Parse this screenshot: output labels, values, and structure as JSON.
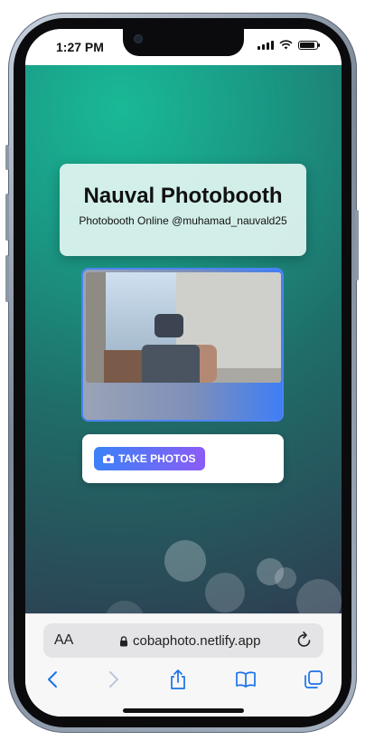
{
  "status_bar": {
    "time": "1:27 PM"
  },
  "app": {
    "title": "Nauval Photobooth",
    "subtitle": "Photobooth Online @muhamad_nauvald25",
    "take_photos_label": "TAKE PHOTOS"
  },
  "browser": {
    "url": "cobaphoto.netlify.app",
    "aa_label": "AA",
    "toolbar": [
      "back",
      "forward",
      "share",
      "bookmarks",
      "tabs"
    ]
  },
  "icons": {
    "camera": "camera-icon",
    "lock": "lock-icon",
    "reload": "reload-icon",
    "back": "chevron-left-icon",
    "forward": "chevron-right-icon",
    "share": "share-icon",
    "bookmarks": "book-icon",
    "tabs": "tabs-icon"
  },
  "colors": {
    "accent_blue": "#3b82f6",
    "accent_purple": "#8b5cf6",
    "safari_blue": "#1a73e8"
  }
}
